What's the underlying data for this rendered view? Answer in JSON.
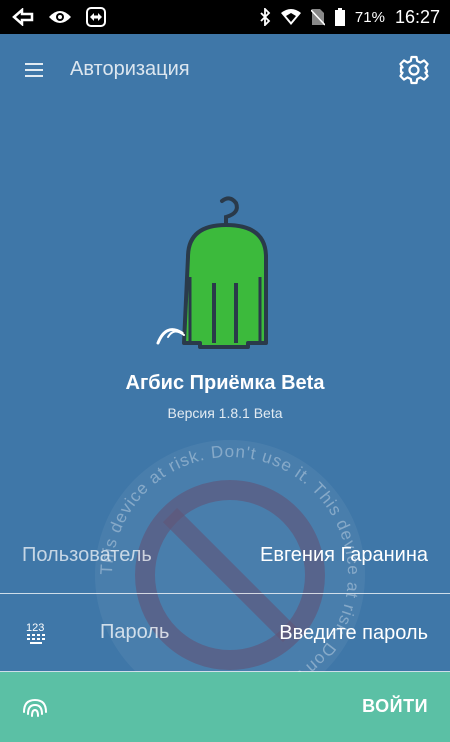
{
  "statusbar": {
    "battery": "71%",
    "time": "16:27",
    "icons": [
      "navigation-icon",
      "eye-icon",
      "teamviewer-icon",
      "bluetooth-icon",
      "wifi-icon",
      "no-sim-icon",
      "battery-icon"
    ]
  },
  "toolbar": {
    "title": "Авторизация",
    "menu_icon": "hamburger-menu-icon",
    "settings_icon": "gear-icon"
  },
  "app": {
    "name": "Агбис Приёмка Beta",
    "version": "Версия 1.8.1 Beta"
  },
  "form": {
    "user_label": "Пользователь",
    "user_value": "Евгения Гаранина",
    "password_label": "Пароль",
    "password_placeholder": "Введите пароль"
  },
  "watermark": {
    "text": "This device at risk. Don't use it. This device at risk. Don't use it."
  },
  "bottom": {
    "login_label": "ВОЙТИ",
    "fingerprint_icon": "fingerprint-icon"
  },
  "colors": {
    "background": "#3f77a8",
    "accent": "#5bc0a5",
    "logo_green": "#3cba3c"
  }
}
